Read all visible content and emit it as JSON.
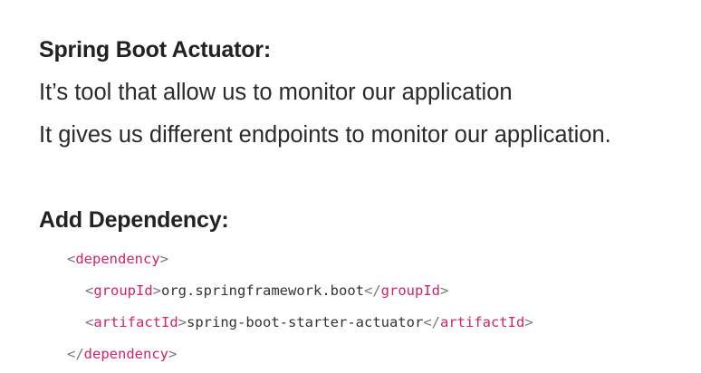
{
  "section1": {
    "heading": "Spring Boot Actuator:",
    "lines": [
      "It’s tool that allow us to monitor our application",
      "It gives us different endpoints to monitor our application."
    ]
  },
  "section2": {
    "heading": "Add Dependency:"
  },
  "code": {
    "lt": "<",
    "gt": ">",
    "lt_slash": "</",
    "dependency_tag": "dependency",
    "groupId_tag": "groupId",
    "groupId_value": "org.springframework.boot",
    "artifactId_tag": "artifactId",
    "artifactId_value": "spring-boot-starter-actuator"
  },
  "colors": {
    "text": "#222222",
    "tag": "#d1246b",
    "punctuation": "#777777"
  }
}
